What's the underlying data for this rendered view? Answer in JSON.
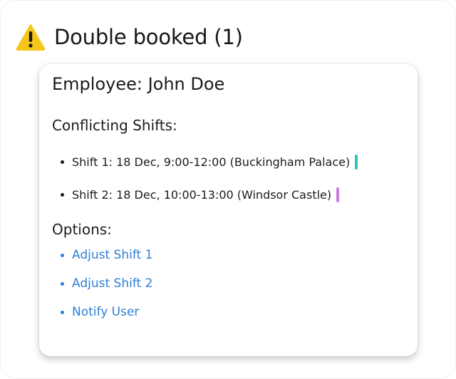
{
  "header": {
    "icon": "warning-icon",
    "title": "Double booked (1)"
  },
  "card": {
    "employee_label": "Employee: John Doe",
    "conflicts_title": "Conflicting Shifts:",
    "shifts": [
      {
        "text": "Shift 1: 18 Dec, 9:00-12:00 (Buckingham Palace)",
        "color": "#2ec4b6"
      },
      {
        "text": "Shift 2: 18 Dec, 10:00-13:00 (Windsor Castle)",
        "color": "#c77dde"
      }
    ],
    "options_title": "Options:",
    "options": [
      {
        "label": "Adjust Shift 1"
      },
      {
        "label": "Adjust Shift 2"
      },
      {
        "label": "Notify User"
      }
    ]
  },
  "colors": {
    "warning": "#f5c518",
    "link": "#2e7fd6",
    "text": "#1b1b1b"
  }
}
